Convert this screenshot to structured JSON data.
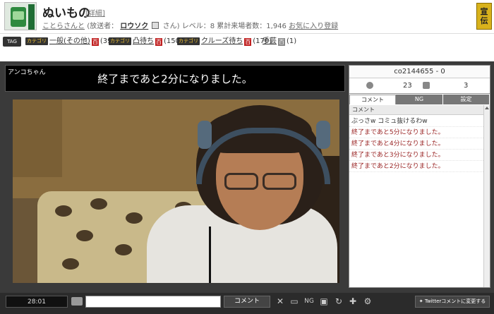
{
  "header": {
    "title": "ぬいもの",
    "detail_link": "[詳細]",
    "community_user": "ことらさんと",
    "broadcaster_prefix": "(放送者：",
    "broadcaster_name": "ロウソク",
    "broadcaster_suffix": "さん)",
    "stats": "レベル：8 累計来場者数：1,946",
    "favorite_link": "お気に入り登録",
    "ad_label": "宣伝"
  },
  "tags": {
    "label": "TAG",
    "items": [
      {
        "category": "カテゴリ",
        "name": "一般(その他)",
        "dic": "百",
        "count": "(391)"
      },
      {
        "category": "カテゴリ",
        "name": "凸待ち",
        "dic": "百",
        "count": "(150)"
      },
      {
        "category": "カテゴリ",
        "name": "クルーズ待ち",
        "dic": "百",
        "count": "(170)"
      },
      {
        "category": "",
        "name": "手芸",
        "dic": "百",
        "count": "(1)"
      }
    ]
  },
  "player": {
    "broadcaster_label": "アンコちゃん",
    "telop": "終了まであと2分になりました。"
  },
  "panel": {
    "community_id": "co2144655 - 0",
    "viewers": "23",
    "comments": "3",
    "tabs": [
      "コメント",
      "NG",
      "設定"
    ],
    "list_header": "コメント",
    "comments_list": [
      {
        "text": "ぶっさw コミュ抜けるわw",
        "system": false
      },
      {
        "text": "終了まであと5分になりました。",
        "system": true
      },
      {
        "text": "終了まであと4分になりました。",
        "system": true
      },
      {
        "text": "終了まであと3分になりました。",
        "system": true
      },
      {
        "text": "終了まであと2分になりました。",
        "system": true
      }
    ]
  },
  "bottom": {
    "time": "28:01",
    "comment_value": "",
    "comment_button": "コメント",
    "twitter_button": "Twitterコメントに変更する"
  },
  "icons": [
    "user-icon",
    "comment-bubble-icon",
    "keyboard-icon",
    "mute-icon",
    "chat-icon",
    "ng-icon",
    "screen-icon",
    "reload-icon",
    "gamepad-icon",
    "settings-icon",
    "twitter-icon"
  ]
}
